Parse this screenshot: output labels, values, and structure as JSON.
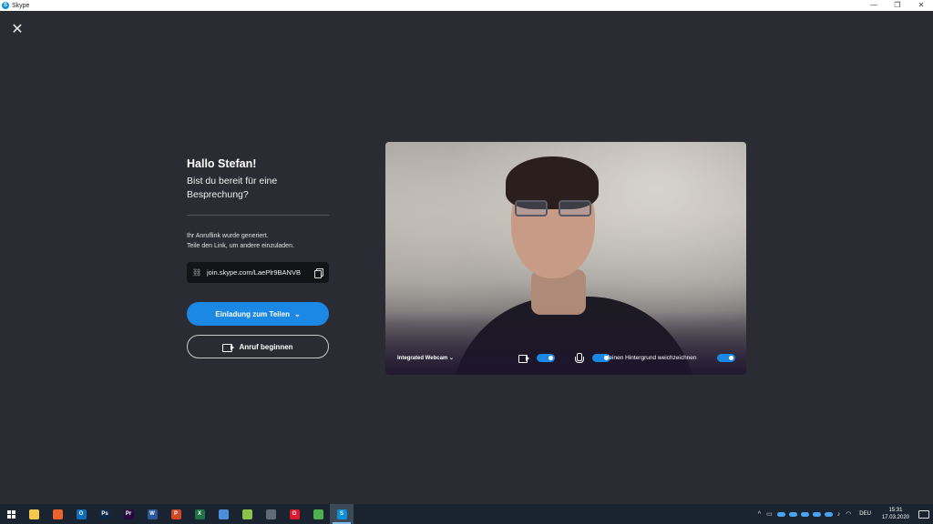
{
  "window": {
    "title": "Skype",
    "minimize": "—",
    "restore": "❐",
    "close": "✕"
  },
  "overlay": {
    "close_glyph": "✕"
  },
  "meeting": {
    "greeting": "Hallo Stefan!",
    "question": "Bist du bereit für eine Besprechung?",
    "info_line1": "Ihr Anruflink wurde generiert.",
    "info_line2": "Teile den Link, um andere einzuladen.",
    "link": "join.skype.com/LaePlr9BANVB",
    "invite_button": "Einladung zum Teilen",
    "start_button": "Anruf beginnen"
  },
  "preview": {
    "camera_label": "Integrated Webcam",
    "camera_chevron": "⌄",
    "blur_label": "Meinen Hintergrund weichzeichnen",
    "video_on": true,
    "mic_on": true,
    "blur_on": true
  },
  "taskbar": {
    "apps": [
      {
        "name": "file-explorer",
        "label": "",
        "color": "#f2c94c"
      },
      {
        "name": "firefox",
        "label": "",
        "color": "#e8642c"
      },
      {
        "name": "outlook",
        "label": "O",
        "color": "#0f6cbd"
      },
      {
        "name": "photoshop",
        "label": "Ps",
        "color": "#0b2a4a"
      },
      {
        "name": "premiere",
        "label": "Pr",
        "color": "#2a0a3e"
      },
      {
        "name": "word",
        "label": "W",
        "color": "#2b579a"
      },
      {
        "name": "powerpoint",
        "label": "P",
        "color": "#d24726"
      },
      {
        "name": "excel",
        "label": "X",
        "color": "#217346"
      },
      {
        "name": "snipping",
        "label": "",
        "color": "#4c8ed9"
      },
      {
        "name": "notepad",
        "label": "",
        "color": "#8bc34a"
      },
      {
        "name": "calculator",
        "label": "",
        "color": "#5f6b77"
      },
      {
        "name": "opera",
        "label": "O",
        "color": "#e0182d"
      },
      {
        "name": "chrome",
        "label": "",
        "color": "#4caf50"
      },
      {
        "name": "skype",
        "label": "S",
        "color": "#0a8fd8"
      }
    ],
    "language": "DEU",
    "time": "15:31",
    "date": "17.03.2020"
  },
  "colors": {
    "background": "#2b2c33",
    "accent": "#1a88e4",
    "taskbar": "#1a2430"
  }
}
